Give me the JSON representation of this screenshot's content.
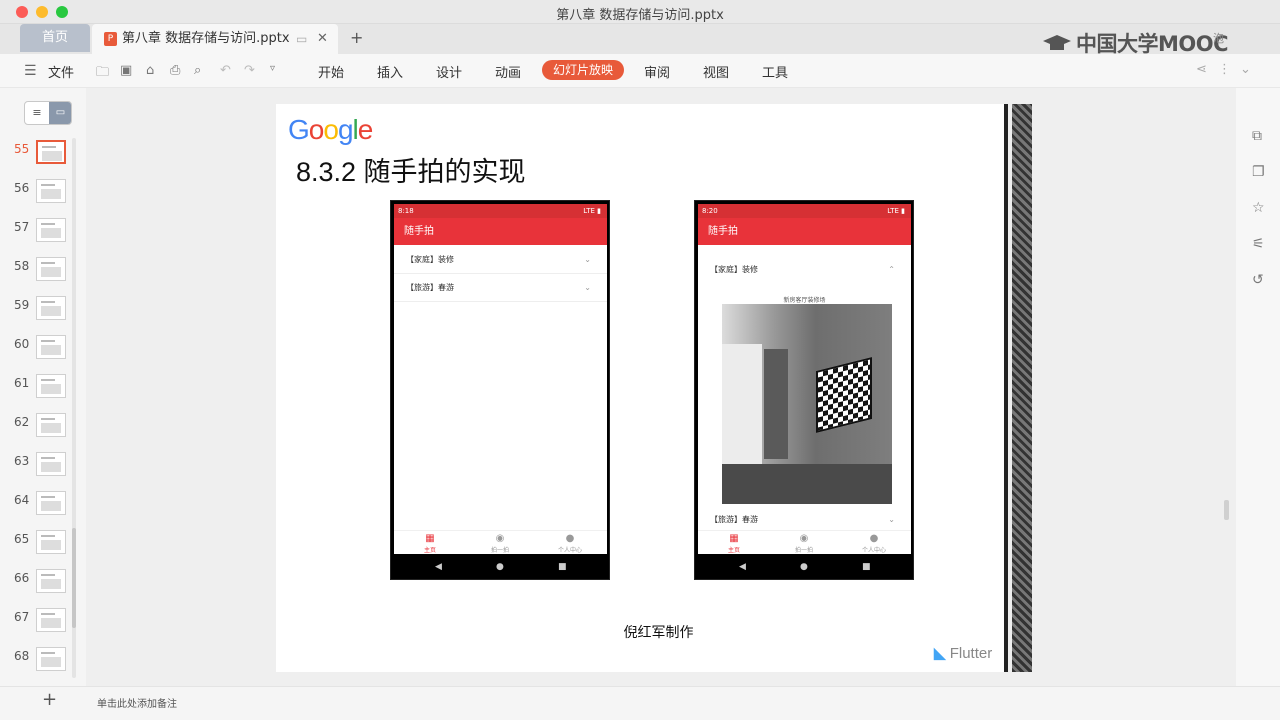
{
  "window": {
    "title": "第八章 数据存储与访问.pptx"
  },
  "tabs": {
    "home": "首页",
    "doc": "第八章 数据存储与访问.pptx",
    "doc_icon": "P",
    "close": "✕",
    "add": "+"
  },
  "branding": {
    "mooc": "中国大学MOOC",
    "extra": "泡"
  },
  "toolbar": {
    "menu_icon": "☰",
    "file": "文件",
    "tabs": [
      "开始",
      "插入",
      "设计",
      "动画",
      "幻灯片放映",
      "审阅",
      "视图",
      "工具"
    ],
    "active_tab": "幻灯片放映",
    "accent": "#e85a3a"
  },
  "slides_panel": {
    "numbers": [
      "55",
      "56",
      "57",
      "58",
      "59",
      "60",
      "61",
      "62",
      "63",
      "64",
      "65",
      "66",
      "67",
      "68"
    ],
    "active": "55"
  },
  "slide": {
    "logo": {
      "g1": "G",
      "o1": "o",
      "o2": "o",
      "g2": "g",
      "l": "l",
      "e": "e"
    },
    "title": "8.3.2 随手拍的实现",
    "author": "倪红军制作",
    "flutter_label": "Flutter",
    "phone_left": {
      "time": "8:18",
      "status_right": "LTE ▮",
      "app_title": "随手拍",
      "items": [
        {
          "label": "【家庭】装修",
          "chevron": "⌄"
        },
        {
          "label": "【旅游】春游",
          "chevron": "⌄"
        }
      ],
      "nav": [
        {
          "icon": "▦",
          "label": "主页"
        },
        {
          "icon": "◉",
          "label": "拍一拍"
        },
        {
          "icon": "●",
          "label": "个人中心"
        }
      ],
      "sysnav": [
        "◀",
        "●",
        "■"
      ]
    },
    "phone_right": {
      "time": "8:20",
      "status_right": "LTE ▮",
      "app_title": "随手拍",
      "item_top": {
        "label": "【家庭】装修",
        "chevron": "⌃"
      },
      "photo_caption": "新房客厅装修场",
      "item_bottom": {
        "label": "【旅游】春游",
        "chevron": "⌄"
      },
      "nav": [
        {
          "icon": "▦",
          "label": "主页"
        },
        {
          "icon": "◉",
          "label": "拍一拍"
        },
        {
          "icon": "●",
          "label": "个人中心"
        }
      ],
      "sysnav": [
        "◀",
        "●",
        "■"
      ]
    }
  },
  "statusbar": {
    "add": "+",
    "notes": "单击此处添加备注"
  }
}
